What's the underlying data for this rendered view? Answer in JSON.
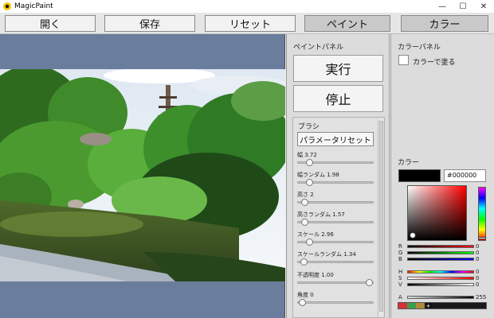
{
  "window": {
    "title": "MagicPaint",
    "controls": [
      "—",
      "☐",
      "✕"
    ]
  },
  "toolbar": {
    "open": "開く",
    "save": "保存",
    "reset": "リセット",
    "paint": "ペイント",
    "color": "カラー"
  },
  "paint_panel": {
    "title": "ペイントパネル",
    "run": "実行",
    "stop": "停止",
    "brush": {
      "title": "ブラシ",
      "reset_params": "パラメータリセット",
      "sliders": [
        {
          "label": "幅 3.72",
          "fraction": 0.12
        },
        {
          "label": "幅ランダム 1.98",
          "fraction": 0.12
        },
        {
          "label": "高さ 2",
          "fraction": 0.06
        },
        {
          "label": "高さランダム 1.57",
          "fraction": 0.06
        },
        {
          "label": "スケール 2.96",
          "fraction": 0.12
        },
        {
          "label": "スケールランダム 1.34",
          "fraction": 0.04
        },
        {
          "label": "不透明度 1.00",
          "fraction": 0.98
        },
        {
          "label": "角度 0",
          "fraction": 0.02
        }
      ]
    }
  },
  "color_panel": {
    "title": "カラーパネル",
    "paint_with_color": "カラーで塗る",
    "color_label": "カラー",
    "hex": "#000000",
    "channels": [
      {
        "label": "R",
        "value": "0",
        "from": "#000000",
        "to": "#ff0000"
      },
      {
        "label": "G",
        "value": "0",
        "from": "#000000",
        "to": "#00ff00"
      },
      {
        "label": "B",
        "value": "0",
        "from": "#000000",
        "to": "#0000ff"
      },
      {
        "label": "H",
        "value": "0",
        "from": "#ff0000",
        "to": "#ff0000",
        "hue": true
      },
      {
        "label": "S",
        "value": "0",
        "from": "#ffffff",
        "to": "#ff0000"
      },
      {
        "label": "V",
        "value": "0",
        "from": "#000000",
        "to": "#ffffff"
      },
      {
        "label": "A",
        "value": "255",
        "from": "#dcdcdc",
        "to": "#000000"
      }
    ],
    "presets": [
      "#d6303a",
      "#3ca04a",
      "#b08a3a"
    ],
    "add_symbol": "+"
  }
}
